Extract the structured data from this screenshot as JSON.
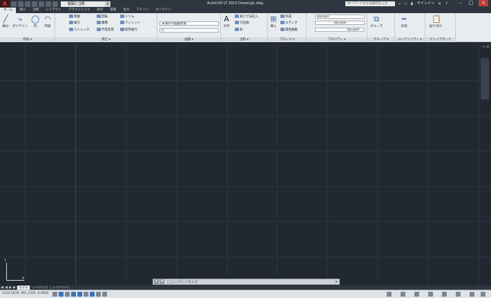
{
  "titlebar": {
    "logo": "A",
    "workspace": "製図と注釈",
    "title": "AutoCAD LT 2013   Drawing1.dwg",
    "search_placeholder": "キーワードまたは語句を入力",
    "signin": "サインイン"
  },
  "tabs": [
    "ホーム",
    "挿入",
    "注釈",
    "レイアウト",
    "パラメトリック",
    "表示",
    "管理",
    "出力",
    "アドイン",
    "オンライン"
  ],
  "ribbon": {
    "draw": {
      "title": "作成 ▾",
      "line": "線分",
      "polyline": "ポリライン",
      "circle": "円",
      "arc": "円弧"
    },
    "modify": {
      "title": "修正 ▾",
      "move": "移動",
      "copy": "複写",
      "stretch": "ストレッチ",
      "rotate": "回転",
      "mirror": "鏡像",
      "scale": "尺度変更",
      "trim": "トリム",
      "fillet": "フィレット",
      "array": "配列複写"
    },
    "layers": {
      "title": "画層 ▾",
      "state": "未保存の画層状態",
      "current": "0"
    },
    "annotation": {
      "title": "注釈 ▾",
      "text": "文字",
      "dimension": "長さ寸法記入",
      "leader": "引出線",
      "table": "表"
    },
    "block": {
      "title": "ブロック ▾",
      "insert": "挿入",
      "create": "作成",
      "edit": "エディタ",
      "attr": "属性編集"
    },
    "properties": {
      "title": "プロパティ ▾",
      "color": "ByLayer",
      "linetype": "ByLayer",
      "lineweight": "ByLayer"
    },
    "groups": {
      "title": "グループ ▾",
      "group": "グループ"
    },
    "utilities": {
      "title": "ユーティリティ ▾",
      "measure": "計測"
    },
    "clipboard": {
      "title": "クリップボード",
      "paste": "貼り付け"
    }
  },
  "viewport": {
    "controls": "- ▫ ×",
    "ucs_x": "X",
    "ucs_y": "Y"
  },
  "command": {
    "prompt": "ここにコマンドを入力",
    "dropdown": "▾"
  },
  "layout_tabs": {
    "nav": [
      "◀",
      "◀",
      "▶",
      "▶"
    ],
    "tabs": [
      "モデル",
      "レイアウト1",
      "レイアウト2"
    ]
  },
  "status": {
    "coords": "1234.5678, 901.2345, 0.0000"
  }
}
